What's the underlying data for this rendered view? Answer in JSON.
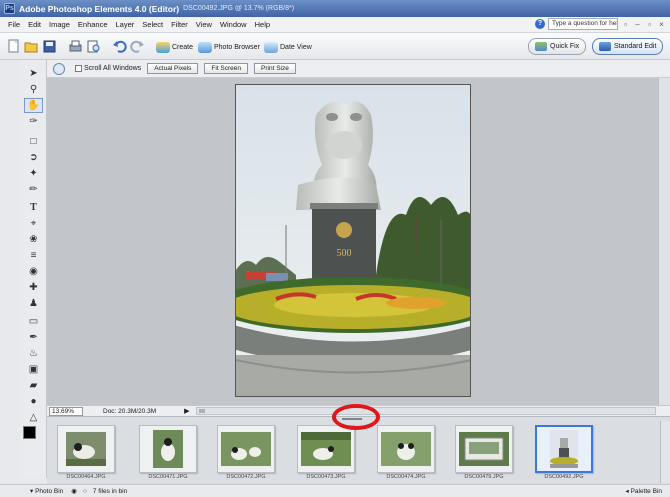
{
  "titlebar": {
    "title": "Adobe Photoshop Elements 4.0 (Editor)",
    "document": "DSC00492.JPG @ 13.7% (RGB/8*)"
  },
  "menu": {
    "items": [
      "File",
      "Edit",
      "Image",
      "Enhance",
      "Layer",
      "Select",
      "Filter",
      "View",
      "Window",
      "Help"
    ]
  },
  "help": {
    "placeholder": "Type a question for help"
  },
  "shortcuts": {
    "create": "Create",
    "photo_browser": "Photo Browser",
    "date_view": "Date View",
    "quick_fix": "Quick Fix",
    "standard_edit": "Standard Edit"
  },
  "options": {
    "scroll_all": "Scroll All Windows",
    "actual_pixels": "Actual Pixels",
    "fit_screen": "Fit Screen",
    "print_size": "Print Size"
  },
  "status": {
    "zoom": "13.69%",
    "doc": "Doc: 20.3M/20.3M",
    "arrow": "▶"
  },
  "bin": {
    "thumbnails": [
      {
        "name": "DSC00464.JPG",
        "selected": false
      },
      {
        "name": "DSC00471.JPG",
        "selected": false
      },
      {
        "name": "DSC00472.JPG",
        "selected": false
      },
      {
        "name": "DSC00473.JPG",
        "selected": false
      },
      {
        "name": "DSC00474.JPG",
        "selected": false
      },
      {
        "name": "DSC00479.JPG",
        "selected": false
      },
      {
        "name": "DSC00492.JPG",
        "selected": true
      }
    ]
  },
  "bottom": {
    "photo_bin": "Photo Bin",
    "files_in_bin": "7 files in bin",
    "palette_bin": "Palette Bin"
  },
  "colors": {
    "title_bar": "#4a6fb0",
    "selection": "#3d78d8",
    "annotation": "#e0161b"
  },
  "icons": [
    "new-icon",
    "open-icon",
    "save-icon",
    "print-icon",
    "undo-icon",
    "redo-icon",
    "zoom-icon",
    "hand-icon",
    "move-icon",
    "brush-icon",
    "type-icon"
  ]
}
